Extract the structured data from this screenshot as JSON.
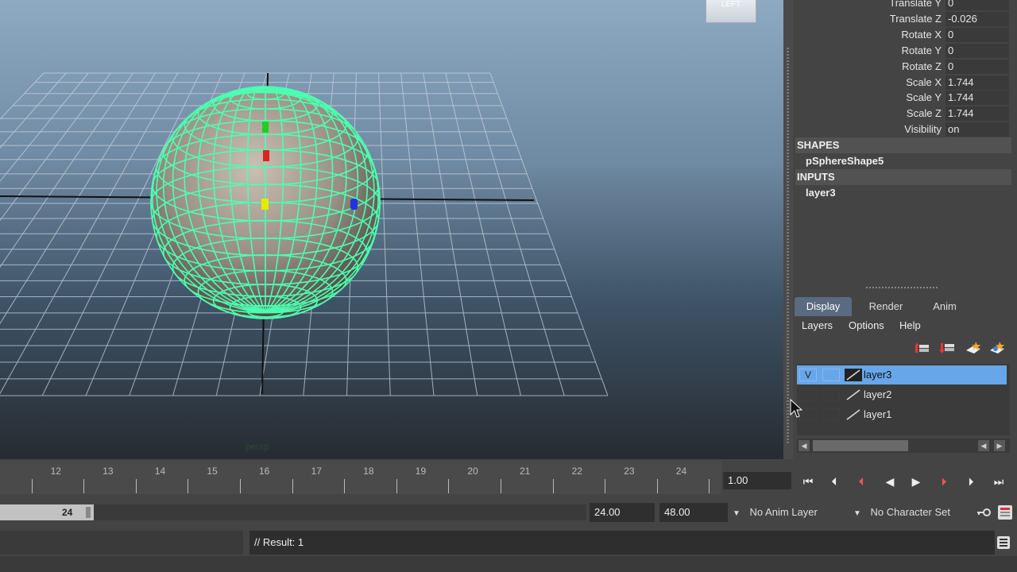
{
  "viewport": {
    "camera_label": "persp",
    "viewcube_label": "LEFT"
  },
  "channel_box": {
    "attributes": [
      {
        "label": "Translate Y",
        "value": "0"
      },
      {
        "label": "Translate Z",
        "value": "-0.026"
      },
      {
        "label": "Rotate X",
        "value": "0"
      },
      {
        "label": "Rotate Y",
        "value": "0"
      },
      {
        "label": "Rotate Z",
        "value": "0"
      },
      {
        "label": "Scale X",
        "value": "1.744"
      },
      {
        "label": "Scale Y",
        "value": "1.744"
      },
      {
        "label": "Scale Z",
        "value": "1.744"
      },
      {
        "label": "Visibility",
        "value": "on"
      }
    ],
    "shapes_header": "SHAPES",
    "shape_node": "pSphereShape5",
    "inputs_header": "INPUTS",
    "input_node": "layer3"
  },
  "layer_editor": {
    "tabs": [
      "Display",
      "Render",
      "Anim"
    ],
    "menus": [
      "Layers",
      "Options",
      "Help"
    ],
    "layers": [
      {
        "visible": "V",
        "name": "layer3",
        "selected": true
      },
      {
        "visible": "",
        "name": "layer2",
        "selected": false
      },
      {
        "visible": "",
        "name": "layer1",
        "selected": false
      }
    ]
  },
  "time_slider": {
    "frame_numbers": [
      "12",
      "13",
      "14",
      "15",
      "16",
      "17",
      "18",
      "19",
      "20",
      "21",
      "22",
      "23",
      "24"
    ],
    "current_time": "1.00"
  },
  "range_slider": {
    "range_end_display": "24",
    "playback_end": "24.00",
    "animation_end": "48.00",
    "anim_layer": "No Anim Layer",
    "character_set": "No Character Set"
  },
  "command_line": {
    "result": "// Result: 1"
  },
  "colors": {
    "wireframe": "#4dffb0",
    "selected_layer": "#67a6e8",
    "active_tab": "#5a6a80"
  }
}
